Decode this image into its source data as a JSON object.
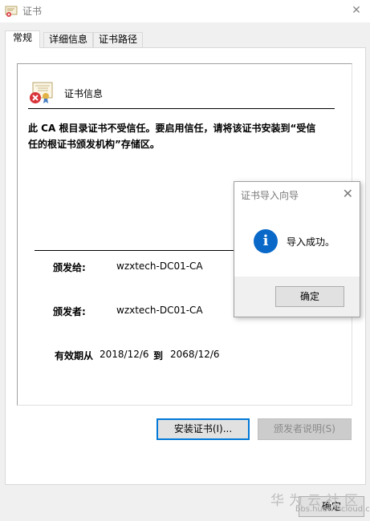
{
  "window": {
    "title": "证书",
    "close_glyph": "✕"
  },
  "tabs": [
    {
      "label": "常规",
      "active": true
    },
    {
      "label": "详细信息",
      "active": false
    },
    {
      "label": "证书路径",
      "active": false
    }
  ],
  "cert": {
    "icon": "certificate-error-icon",
    "header": "证书信息",
    "warning": "此 CA 根目录证书不受信任。要启用信任，请将该证书安装到“受信任的根证书颁发机构”存储区。",
    "issued_to_label": "颁发给:",
    "issued_to_value": "wzxtech-DC01-CA",
    "issued_by_label": "颁发者:",
    "issued_by_value": "wzxtech-DC01-CA",
    "validity_label": "有效期从",
    "valid_from": "2018/12/6",
    "to_label": "到",
    "valid_to": "2068/12/6"
  },
  "buttons": {
    "install": "安装证书(I)...",
    "issuer_statement": "颁发者说明(S)",
    "ok": "确定"
  },
  "dialog": {
    "title": "证书导入向导",
    "close_glyph": "✕",
    "icon": "info-icon",
    "icon_glyph": "i",
    "message": "导入成功。",
    "ok": "确定"
  },
  "watermark": {
    "text": "华为云社区",
    "url": "bbs.huaweicloud.com"
  },
  "colors": {
    "accent": "#0078d7",
    "info": "#0a69c8",
    "error": "#d9343a"
  }
}
